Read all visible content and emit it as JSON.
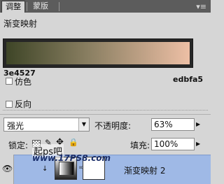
{
  "tabs": [
    {
      "label": "调整",
      "active": true
    },
    {
      "label": "蒙版",
      "active": false
    }
  ],
  "adjustment": {
    "title": "渐变映射",
    "gradient": {
      "start_color": "3e4527",
      "end_color": "edbfa5"
    },
    "options": [
      {
        "label": "仿色",
        "checked": false
      },
      {
        "label": "反向",
        "checked": false
      }
    ]
  },
  "layers": {
    "blend_mode": "强光",
    "opacity_label": "不透明度:",
    "opacity_value": "63%",
    "lock_label": "锁定:",
    "fill_label": "填充:",
    "fill_value": "100%",
    "watermark": "起ps吧",
    "watermark_url": "www.17PS8.com",
    "layer": {
      "name": "渐变映射 2"
    }
  },
  "colors": {
    "gradient_start": "#3e4527",
    "gradient_end": "#edbfa5",
    "selected_layer": "#9fb9e6"
  }
}
